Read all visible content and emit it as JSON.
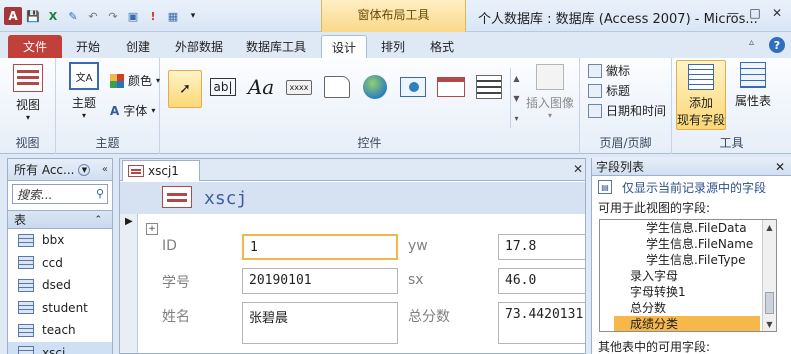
{
  "app": {
    "window_title": "个人数据库 : 数据库 (Access 2007) - Micros...",
    "context_tab_title": "窗体布局工具",
    "app_icon_letter": "A"
  },
  "window_controls": [
    "—",
    "□",
    "✕"
  ],
  "tabs": {
    "file": "文件",
    "items": [
      "开始",
      "创建",
      "外部数据",
      "数据库工具",
      "设计",
      "排列",
      "格式"
    ],
    "active": "设计"
  },
  "ribbon": {
    "groups": {
      "views": {
        "label": "视图",
        "button": "视图"
      },
      "themes": {
        "label": "主题",
        "theme_button": "主题",
        "colors_button": "颜色",
        "fonts_button": "字体"
      },
      "controls": {
        "label": "控件",
        "insert_image": "插入图像",
        "icons": [
          "pointer-icon",
          "textbox-icon",
          "label-icon",
          "button-icon",
          "tab-control-icon",
          "hyperlink-icon",
          "web-browser-icon",
          "navigation-control-icon",
          "option-group-icon"
        ],
        "textbox_glyph": "ab|",
        "label_glyph": "Aa",
        "button_glyph": "xxxx"
      },
      "header_footer": {
        "label": "页眉/页脚",
        "logo": "徽标",
        "title": "标题",
        "date_time": "日期和时间"
      },
      "tools": {
        "label": "工具",
        "add_existing_fields_line1": "添加",
        "add_existing_fields_line2": "现有字段",
        "property_sheet": "属性表"
      }
    }
  },
  "nav_pane": {
    "header": "所有 Acc...",
    "search_placeholder": "搜索...",
    "group_label": "表",
    "items": [
      "bbx",
      "ccd",
      "dsed",
      "student",
      "teach",
      "xscj"
    ],
    "selected": "xscj"
  },
  "document": {
    "tab_title": "xscj1",
    "form_title": "xscj",
    "fields": [
      {
        "label": "ID",
        "value": "1"
      },
      {
        "label": "yw",
        "value": "17.8"
      },
      {
        "label": "学号",
        "value": "20190101"
      },
      {
        "label": "sx",
        "value": "46.0"
      },
      {
        "label": "姓名",
        "value": "张碧晨"
      },
      {
        "label": "总分数",
        "value": "73.4420131"
      }
    ]
  },
  "field_list": {
    "title": "字段列表",
    "show_only_link": "仅显示当前记录源中的字段",
    "available_label": "可用于此视图的字段:",
    "tree_items": [
      "学生信息.FileData",
      "学生信息.FileName",
      "学生信息.FileType",
      "录入字母",
      "字母转换1",
      "总分数",
      "成绩分类"
    ],
    "selected": "成绩分类",
    "other_tables_label": "其他表中的可用字段:"
  }
}
